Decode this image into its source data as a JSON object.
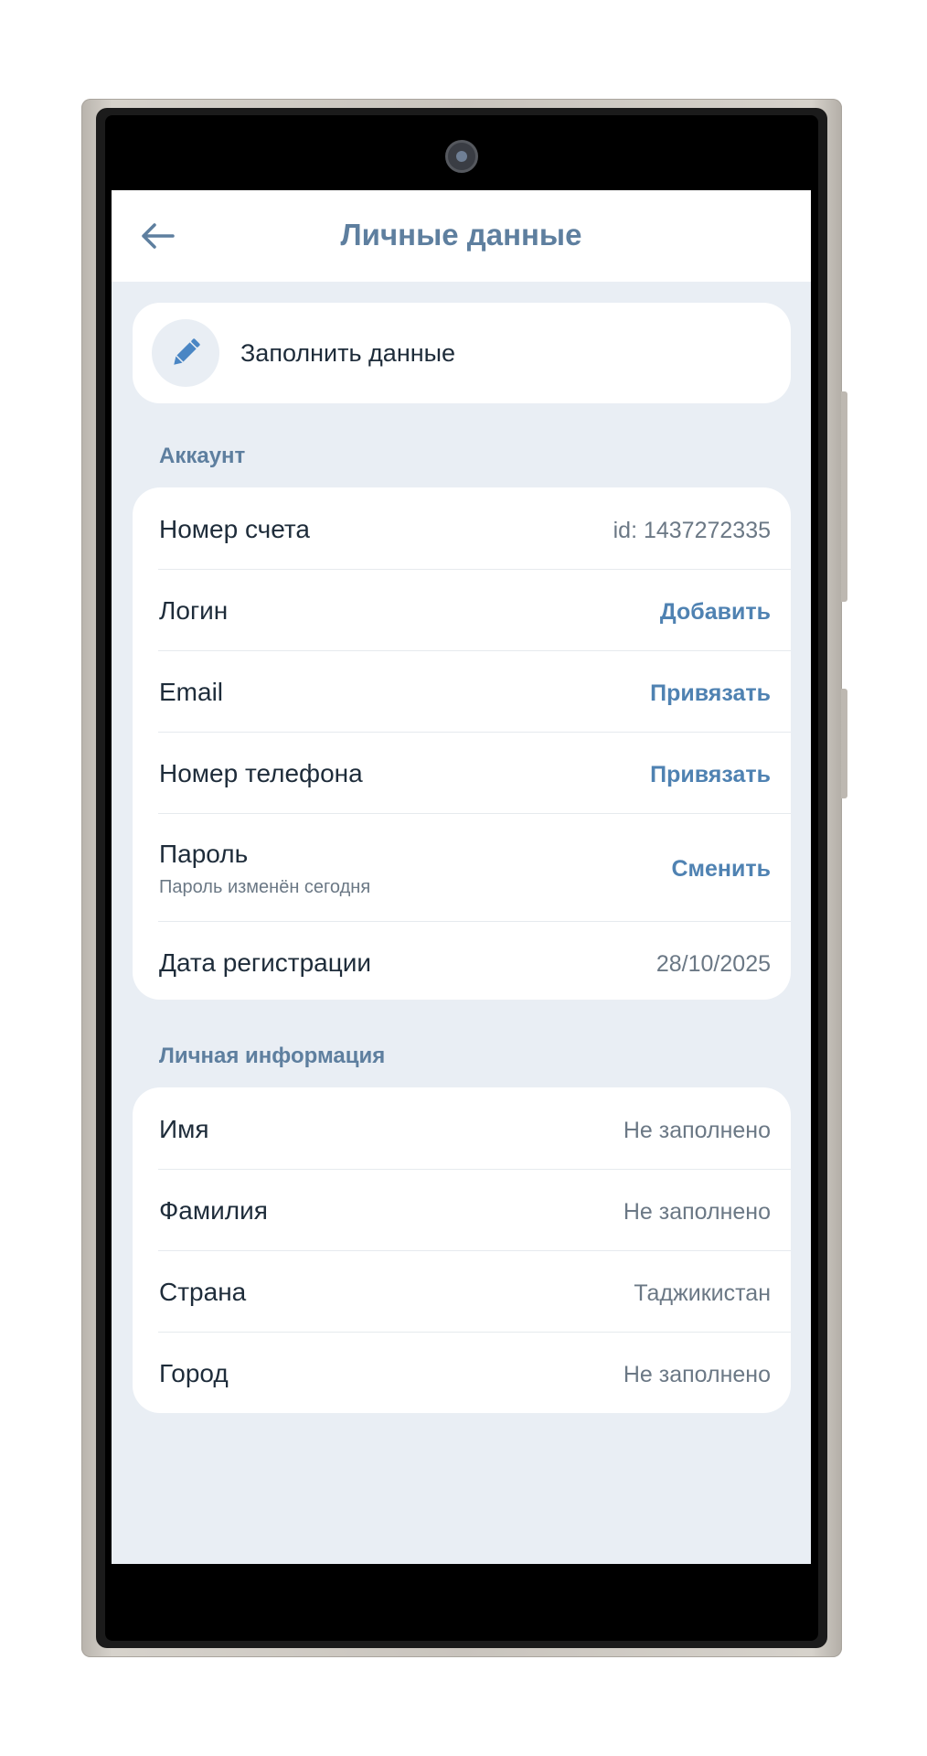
{
  "header": {
    "title": "Личные данные",
    "back_icon": "arrow-left-icon"
  },
  "fill_card": {
    "label": "Заполнить данные",
    "icon": "pencil-icon",
    "accent": "#4a86c4"
  },
  "account": {
    "section_title": "Аккаунт",
    "rows": [
      {
        "label": "Номер счета",
        "value": "id: 1437272335"
      },
      {
        "label": "Логин",
        "action": "Добавить"
      },
      {
        "label": "Email",
        "action": "Привязать"
      },
      {
        "label": "Номер телефона",
        "action": "Привязать"
      },
      {
        "label": "Пароль",
        "sublabel": "Пароль изменён сегодня",
        "action": "Сменить"
      },
      {
        "label": "Дата регистрации",
        "value": "28/10/2025"
      }
    ]
  },
  "personal": {
    "section_title": "Личная информация",
    "rows": [
      {
        "label": "Имя",
        "value": "Не заполнено"
      },
      {
        "label": "Фамилия",
        "value": "Не заполнено"
      },
      {
        "label": "Страна",
        "value": "Таджикистан"
      },
      {
        "label": "Город",
        "value": "Не заполнено"
      }
    ]
  },
  "colors": {
    "title": "#5e7f9f",
    "action": "#4f82b2",
    "background": "#e9eef4",
    "card": "#ffffff"
  }
}
